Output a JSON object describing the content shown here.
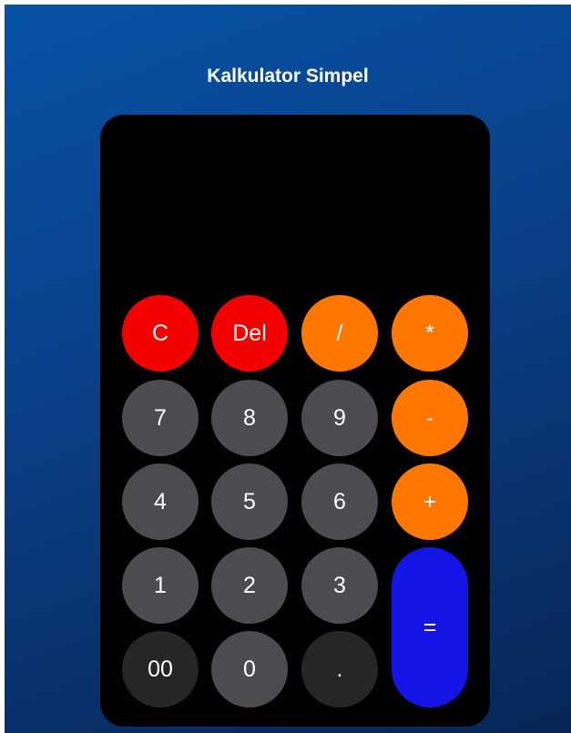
{
  "app": {
    "title": "Kalkulator Simpel"
  },
  "display": {
    "value": ""
  },
  "keys": {
    "clear": "C",
    "delete": "Del",
    "divide": "/",
    "multiply": "*",
    "seven": "7",
    "eight": "8",
    "nine": "9",
    "minus": "-",
    "four": "4",
    "five": "5",
    "six": "6",
    "plus": "+",
    "one": "1",
    "two": "2",
    "three": "3",
    "equals": "=",
    "double_zero": "00",
    "zero": "0",
    "decimal": "."
  },
  "colors": {
    "background_top": "#0752a6",
    "background_bottom": "#072657",
    "panel": "#000000",
    "function_key": "#f50000",
    "operator_key": "#ff7700",
    "digit_key": "#4b4c50",
    "dark_key": "#262628",
    "equals_key": "#1414e6"
  }
}
